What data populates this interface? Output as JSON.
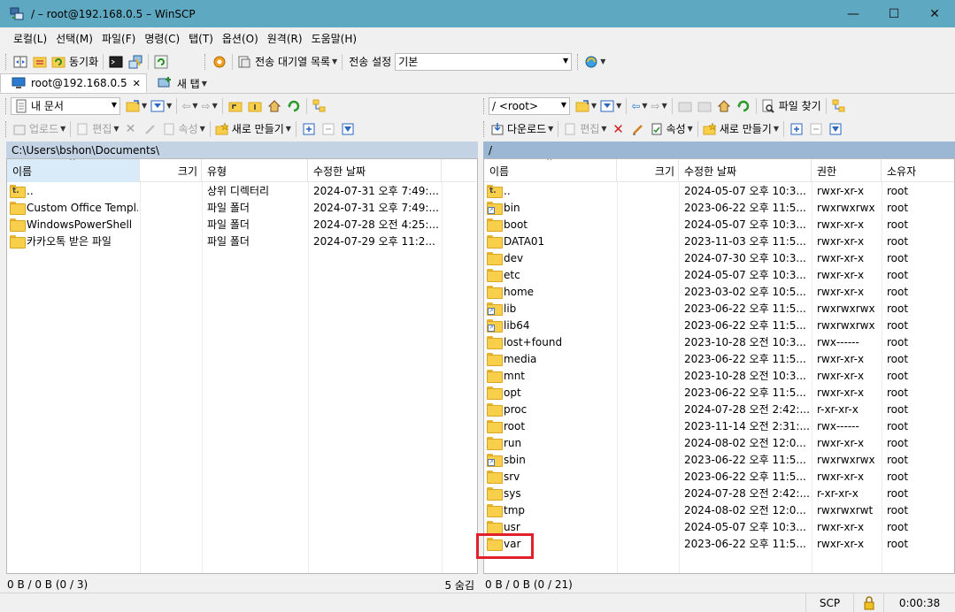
{
  "window": {
    "title": "/ – root@192.168.0.5 – WinSCP",
    "minimize": "—",
    "maximize": "☐",
    "close": "✕"
  },
  "menu": [
    "로컬(L)",
    "선택(M)",
    "파일(F)",
    "명령(C)",
    "탭(T)",
    "옵션(O)",
    "원격(R)",
    "도움말(H)"
  ],
  "toolbar_main": {
    "sync_label": "동기화",
    "queue_label": "전송 대기열 목록",
    "transfer_settings_label": "전송 설정",
    "transfer_settings_value": "기본"
  },
  "tabs": {
    "session_label": "root@192.168.0.5",
    "new_tab_label": "새 탭"
  },
  "left": {
    "location_combo": "내 문서",
    "upload_label": "업로드",
    "edit_label": "편집",
    "properties_label": "속성",
    "new_label": "새로 만들기",
    "path": "C:\\Users\\bshon\\Documents\\",
    "columns": [
      "이름",
      "크기",
      "유형",
      "수정한 날짜"
    ],
    "rows": [
      {
        "name": "..",
        "size": "",
        "type": "상위 디렉터리",
        "modified": "2024-07-31 오후 7:49:...",
        "kind": "up"
      },
      {
        "name": "Custom Office Templ...",
        "size": "",
        "type": "파일 폴더",
        "modified": "2024-07-31 오후 7:49:...",
        "kind": "folder"
      },
      {
        "name": "WindowsPowerShell",
        "size": "",
        "type": "파일 폴더",
        "modified": "2024-07-28 오전 4:25:...",
        "kind": "folder"
      },
      {
        "name": "카카오톡 받은 파일",
        "size": "",
        "type": "파일 폴더",
        "modified": "2024-07-29 오후 11:2...",
        "kind": "folder"
      }
    ],
    "status": "0 B / 0 B (0 / 3)",
    "hidden": "5 숨김"
  },
  "right": {
    "location_combo": "/  <root>",
    "find_label": "파일 찾기",
    "download_label": "다운로드",
    "edit_label": "편집",
    "properties_label": "속성",
    "new_label": "새로 만들기",
    "path": "/",
    "columns": [
      "이름",
      "크기",
      "수정한 날짜",
      "권한",
      "소유자"
    ],
    "rows": [
      {
        "name": "..",
        "modified": "2024-05-07 오후 10:3...",
        "perm": "rwxr-xr-x",
        "owner": "root",
        "kind": "up"
      },
      {
        "name": "bin",
        "modified": "2023-06-22 오후 11:5...",
        "perm": "rwxrwxrwx",
        "owner": "root",
        "kind": "link"
      },
      {
        "name": "boot",
        "modified": "2024-05-07 오후 10:3...",
        "perm": "rwxr-xr-x",
        "owner": "root",
        "kind": "folder"
      },
      {
        "name": "DATA01",
        "modified": "2023-11-03 오후 11:5...",
        "perm": "rwxr-xr-x",
        "owner": "root",
        "kind": "folder"
      },
      {
        "name": "dev",
        "modified": "2024-07-30 오후 10:3...",
        "perm": "rwxr-xr-x",
        "owner": "root",
        "kind": "folder"
      },
      {
        "name": "etc",
        "modified": "2024-05-07 오후 10:3...",
        "perm": "rwxr-xr-x",
        "owner": "root",
        "kind": "folder"
      },
      {
        "name": "home",
        "modified": "2023-03-02 오후 10:5...",
        "perm": "rwxr-xr-x",
        "owner": "root",
        "kind": "folder"
      },
      {
        "name": "lib",
        "modified": "2023-06-22 오후 11:5...",
        "perm": "rwxrwxrwx",
        "owner": "root",
        "kind": "link"
      },
      {
        "name": "lib64",
        "modified": "2023-06-22 오후 11:5...",
        "perm": "rwxrwxrwx",
        "owner": "root",
        "kind": "link"
      },
      {
        "name": "lost+found",
        "modified": "2023-10-28 오전 10:3...",
        "perm": "rwx------",
        "owner": "root",
        "kind": "folder"
      },
      {
        "name": "media",
        "modified": "2023-06-22 오후 11:5...",
        "perm": "rwxr-xr-x",
        "owner": "root",
        "kind": "folder"
      },
      {
        "name": "mnt",
        "modified": "2023-10-28 오전 10:3...",
        "perm": "rwxr-xr-x",
        "owner": "root",
        "kind": "folder"
      },
      {
        "name": "opt",
        "modified": "2023-06-22 오후 11:5...",
        "perm": "rwxr-xr-x",
        "owner": "root",
        "kind": "folder"
      },
      {
        "name": "proc",
        "modified": "2024-07-28 오전 2:42:...",
        "perm": "r-xr-xr-x",
        "owner": "root",
        "kind": "folder"
      },
      {
        "name": "root",
        "modified": "2023-11-14 오전 2:31:...",
        "perm": "rwx------",
        "owner": "root",
        "kind": "folder"
      },
      {
        "name": "run",
        "modified": "2024-08-02 오전 12:0...",
        "perm": "rwxr-xr-x",
        "owner": "root",
        "kind": "folder"
      },
      {
        "name": "sbin",
        "modified": "2023-06-22 오후 11:5...",
        "perm": "rwxrwxrwx",
        "owner": "root",
        "kind": "link"
      },
      {
        "name": "srv",
        "modified": "2023-06-22 오후 11:5...",
        "perm": "rwxr-xr-x",
        "owner": "root",
        "kind": "folder"
      },
      {
        "name": "sys",
        "modified": "2024-07-28 오전 2:42:...",
        "perm": "r-xr-xr-x",
        "owner": "root",
        "kind": "folder"
      },
      {
        "name": "tmp",
        "modified": "2024-08-02 오전 12:0...",
        "perm": "rwxrwxrwt",
        "owner": "root",
        "kind": "folder"
      },
      {
        "name": "usr",
        "modified": "2024-05-07 오후 10:3...",
        "perm": "rwxr-xr-x",
        "owner": "root",
        "kind": "folder"
      },
      {
        "name": "var",
        "modified": "2023-06-22 오후 11:5...",
        "perm": "rwxr-xr-x",
        "owner": "root",
        "kind": "folder"
      }
    ],
    "status": "0 B / 0 B (0 / 21)"
  },
  "bottom": {
    "protocol": "SCP",
    "elapsed": "0:00:38"
  },
  "colors": {
    "titlebar": "#5fa8c1",
    "highlight": "#e0202a",
    "path_left": "#c3d3e3",
    "path_right": "#9bb7d3"
  }
}
